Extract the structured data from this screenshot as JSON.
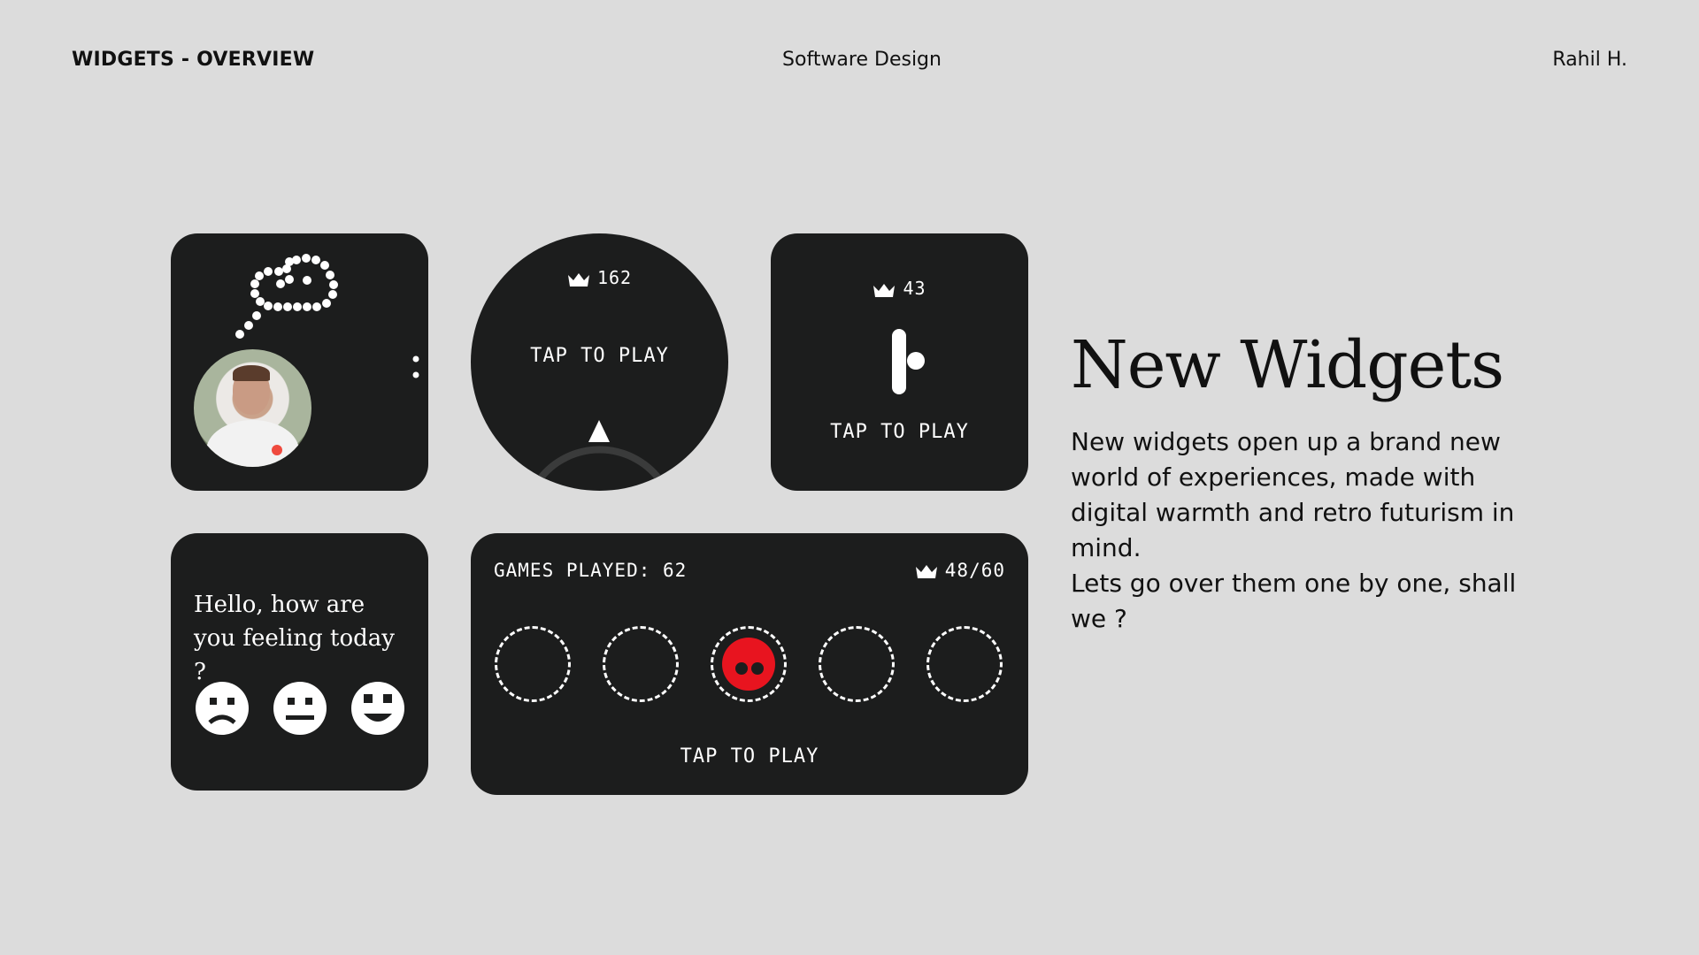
{
  "header": {
    "left": "WIDGETS - OVERVIEW",
    "center": "Software Design",
    "right": "Rahil H."
  },
  "round_widget": {
    "high_score": "162",
    "cta": "TAP TO PLAY"
  },
  "flappy_widget": {
    "high_score": "43",
    "cta": "TAP TO PLAY"
  },
  "mood_widget": {
    "greeting": "Hello, how are you feeling today ?"
  },
  "games_widget": {
    "games_played": "GAMES PLAYED: 62",
    "score": "48/60",
    "cta": "TAP TO PLAY",
    "active_slot": 3
  },
  "main": {
    "title": "New Widgets",
    "paragraph1": "New widgets open up a brand new world of experiences, made with digital warmth and retro futurism in mind.",
    "paragraph2": "Lets go over them one by one, shall we ?"
  },
  "colors": {
    "background": "#dcdcdc",
    "card": "#1c1d1d",
    "accent_red": "#e8141f"
  }
}
